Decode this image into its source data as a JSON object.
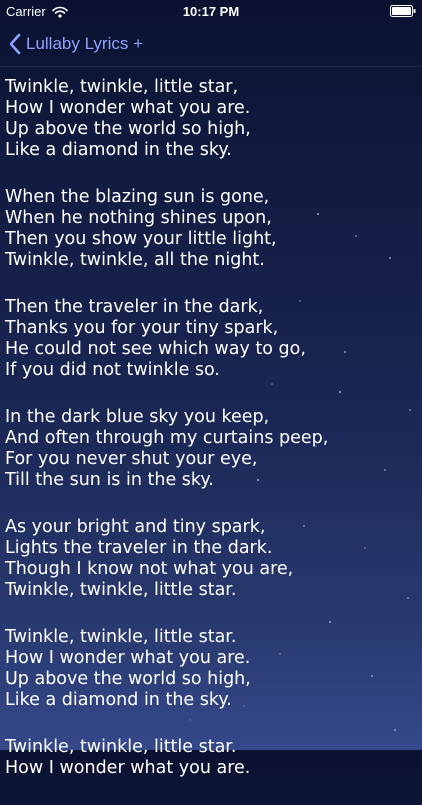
{
  "status_bar": {
    "carrier": "Carrier",
    "time": "10:17 PM",
    "wifi_icon": "wifi-icon",
    "battery_icon": "battery-icon"
  },
  "nav": {
    "back_label": "Lullaby Lyrics +",
    "back_icon": "chevron-left-icon",
    "accent_color": "#8fa0ff"
  },
  "lyrics": {
    "stanzas": [
      [
        "Twinkle, twinkle, little star,",
        "How I wonder what you are.",
        "Up above the world so high,",
        "Like a diamond in the sky."
      ],
      [
        "When the blazing sun is gone,",
        "When he nothing shines upon,",
        "Then you show your little light,",
        "Twinkle, twinkle, all the night."
      ],
      [
        "Then the traveler in the dark,",
        "Thanks you for your tiny spark,",
        "He could not see which way to go,",
        "If you did not twinkle so."
      ],
      [
        "In the dark blue sky you keep,",
        "And often through my curtains peep,",
        "For you never shut your eye,",
        "Till the sun is in the sky."
      ],
      [
        "As your bright and tiny spark,",
        "Lights the traveler in the dark.",
        "Though I know not what you are,",
        "Twinkle, twinkle, little star."
      ],
      [
        "Twinkle, twinkle, little star.",
        "How I wonder what you are.",
        "Up above the world so high,",
        "Like a diamond in the sky."
      ],
      [
        "Twinkle, twinkle, little star.",
        "How I wonder what you are."
      ]
    ]
  },
  "colors": {
    "background_top": "#0b1230",
    "background_bottom": "#35488a",
    "text": "#ffffff"
  }
}
